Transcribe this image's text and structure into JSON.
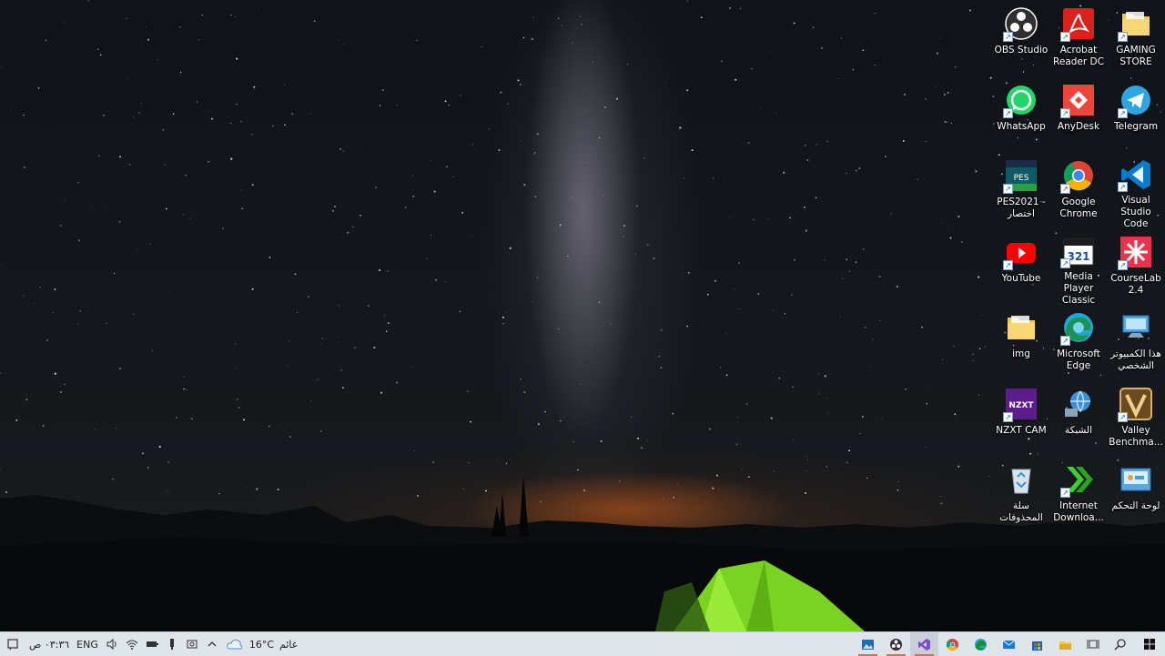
{
  "desktop": {
    "icons": [
      {
        "id": "obs",
        "label": "OBS Studio",
        "icon": "obs-icon",
        "color": "#302e31"
      },
      {
        "id": "acrobat",
        "label": "Acrobat\nReader DC",
        "icon": "acrobat-icon",
        "color": "#d9221c"
      },
      {
        "id": "gaming",
        "label": "GAMING\nSTORE",
        "icon": "folder-icon",
        "color": "#f2c94c"
      },
      {
        "id": "whatsapp",
        "label": "WhatsApp",
        "icon": "whatsapp-icon",
        "color": "#25d366"
      },
      {
        "id": "anydesk",
        "label": "AnyDesk",
        "icon": "anydesk-icon",
        "color": "#ef443b"
      },
      {
        "id": "telegram",
        "label": "Telegram",
        "icon": "telegram-icon",
        "color": "#2ca5e0"
      },
      {
        "id": "pes",
        "label": "PES2021 -\nاختصار",
        "icon": "pes-icon",
        "color": "#0e5b63"
      },
      {
        "id": "chrome",
        "label": "Google\nChrome",
        "icon": "chrome-icon",
        "color": "#4285f4"
      },
      {
        "id": "vscode",
        "label": "Visual Studio\nCode",
        "icon": "vscode-icon",
        "color": "#0a7acc"
      },
      {
        "id": "youtube",
        "label": "YouTube",
        "icon": "youtube-icon",
        "color": "#ff0000"
      },
      {
        "id": "mpc",
        "label": "Media Player\nClassic",
        "icon": "media-player-icon",
        "color": "#1b1b1b"
      },
      {
        "id": "courselab",
        "label": "CourseLab\n2.4",
        "icon": "courselab-icon",
        "color": "#e8344a"
      },
      {
        "id": "img",
        "label": "img",
        "icon": "folder-icon",
        "color": "#f2c94c"
      },
      {
        "id": "edge",
        "label": "Microsoft\nEdge",
        "icon": "edge-icon",
        "color": "#1fa6d6"
      },
      {
        "id": "thispc",
        "label": "هذا الكمبيوتر\nالشخصي",
        "icon": "computer-icon",
        "color": "#4aa8e8"
      },
      {
        "id": "nzxt",
        "label": "NZXT CAM",
        "icon": "nzxt-icon",
        "color": "#5b1d8c"
      },
      {
        "id": "network",
        "label": "الشبكة",
        "icon": "network-icon",
        "color": "#3b8fd8"
      },
      {
        "id": "valley",
        "label": "Valley\nBenchma...",
        "icon": "valley-icon",
        "color": "#6b4a1e"
      },
      {
        "id": "recycle",
        "label": "سلة\nالمحذوفات",
        "icon": "recycle-bin-icon",
        "color": "#d8e4ea"
      },
      {
        "id": "idm",
        "label": "Internet\nDownloa...",
        "icon": "idm-icon",
        "color": "#3ccf2f"
      },
      {
        "id": "control",
        "label": "لوحة التحكم",
        "icon": "control-panel-icon",
        "color": "#5aa7e0"
      }
    ]
  },
  "taskbar": {
    "start_icon": "windows-start-icon",
    "search_icon": "search-icon",
    "taskview_icon": "task-view-icon",
    "pinned": [
      {
        "id": "explorer",
        "icon": "file-explorer-icon",
        "running": false
      },
      {
        "id": "store",
        "icon": "store-icon",
        "running": false
      },
      {
        "id": "mail",
        "icon": "mail-icon",
        "running": false
      },
      {
        "id": "edge",
        "icon": "edge-icon",
        "running": false
      },
      {
        "id": "chrome",
        "icon": "chrome-icon",
        "running": false
      },
      {
        "id": "vs",
        "icon": "visual-studio-icon",
        "running": true
      },
      {
        "id": "obs",
        "icon": "obs-icon",
        "running": true
      },
      {
        "id": "photos",
        "icon": "photos-icon",
        "running": true
      }
    ],
    "weather": {
      "temp": "16°C",
      "condition": "غائم"
    },
    "language": "ENG",
    "clock": "٠٣:٣٦ ص"
  }
}
